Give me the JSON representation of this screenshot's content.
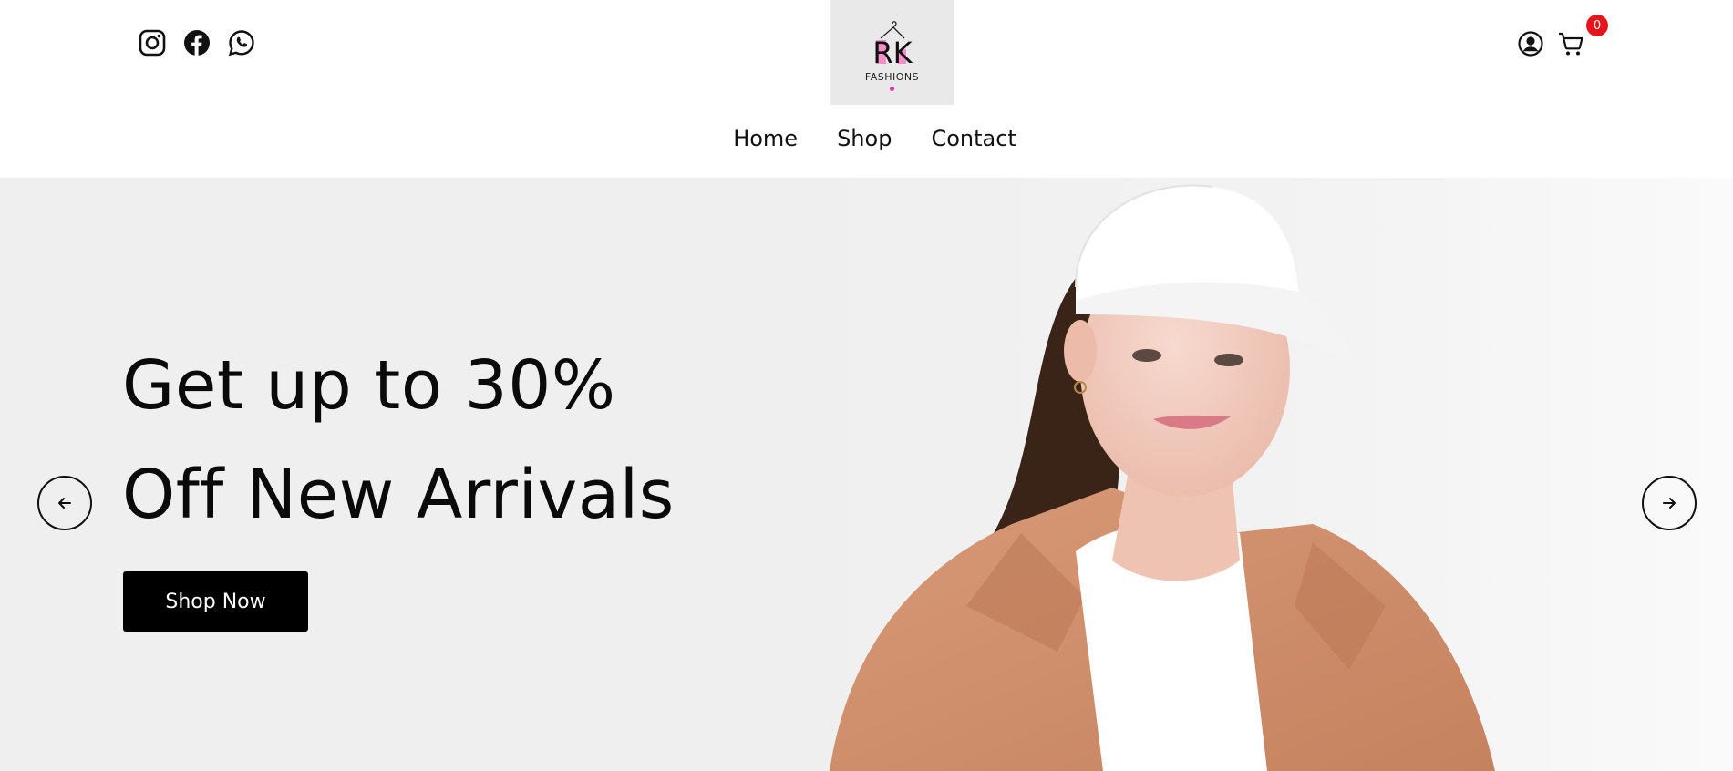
{
  "header": {
    "social": [
      {
        "icon": "instagram-icon"
      },
      {
        "icon": "facebook-icon"
      },
      {
        "icon": "whatsapp-icon"
      }
    ],
    "logo": {
      "monogram": "RK",
      "text": "FASHIONS",
      "accent_color": "#e8319a"
    },
    "cart_count": "0",
    "badge_color": "#e8141c"
  },
  "nav": {
    "items": [
      "Home",
      "Shop",
      "Contact"
    ]
  },
  "hero": {
    "title_line1": "Get up to 30%",
    "title_line2": "Off New Arrivals",
    "cta_label": "Shop Now",
    "background": "#efefef"
  }
}
